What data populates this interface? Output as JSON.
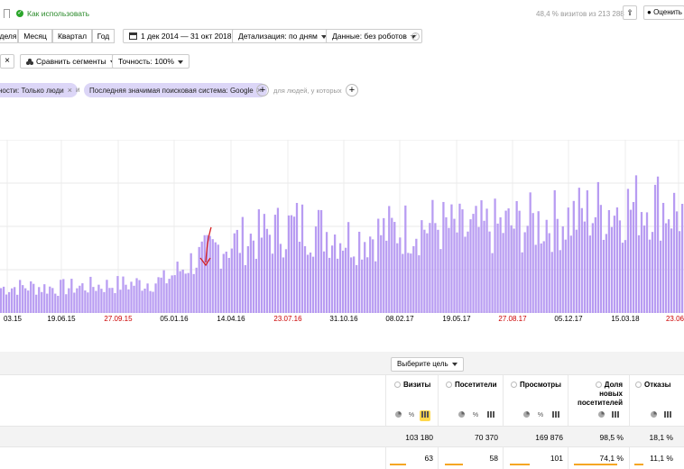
{
  "header": {
    "how_to_use": "Как использовать",
    "visits_share": "48,4 % визитов из 213 288",
    "rate_label": "Оценить"
  },
  "toolbar": {
    "periods": [
      "деля",
      "Месяц",
      "Квартал",
      "Год"
    ],
    "date_range": "1 дек 2014 — 31 окт 2018",
    "detail": "Детализация: по дням",
    "data": "Данные: без роботов",
    "compare_segments": "Сравнить сегменты",
    "accuracy": "Точность: 100%"
  },
  "filters": {
    "chip1": "ности: Только люди",
    "and": "и",
    "chip2": "Последняя значимая поисковая система: Google",
    "people_hint": "для людей, у которых"
  },
  "chart_data": {
    "type": "bar",
    "x_tick_labels": [
      "03.15",
      "19.06.15",
      "27.09.15",
      "05.01.16",
      "14.04.16",
      "23.07.16",
      "31.10.16",
      "08.02.17",
      "19.05.17",
      "27.08.17",
      "05.12.17",
      "15.03.18",
      "23.06"
    ],
    "weekend_tick_color": "#cc0000",
    "weekend_ticks": [
      2,
      5,
      9,
      12
    ],
    "bar_color": "#b89cf2",
    "grid": true,
    "annotation": "red hand-drawn arrow pointing down near 05.01.16",
    "level_profile": [
      0.17,
      0.18,
      0.17,
      0.18,
      0.19,
      0.2,
      0.22,
      0.35,
      0.45,
      0.5,
      0.55,
      0.6,
      0.55,
      0.5,
      0.55,
      0.58,
      0.6,
      0.55,
      0.58,
      0.6,
      0.62,
      0.65,
      0.7,
      0.72,
      0.75,
      0.68
    ]
  },
  "table": {
    "goal_button": "Выберите цель",
    "columns": [
      {
        "name": "Визиты"
      },
      {
        "name": "Посетители"
      },
      {
        "name": "Просмотры"
      },
      {
        "name": "Доля новых посетителей"
      },
      {
        "name": "Отказы"
      }
    ],
    "total_row": [
      "103 180",
      "70 370",
      "169 876",
      "98,5 %",
      "18,1 %"
    ],
    "row2": [
      "63",
      "58",
      "101",
      "74,1 %",
      "11,1 %"
    ],
    "mini_icons": [
      "pie-chart",
      "percent",
      "bar-chart"
    ],
    "percent_glyph": "%"
  }
}
